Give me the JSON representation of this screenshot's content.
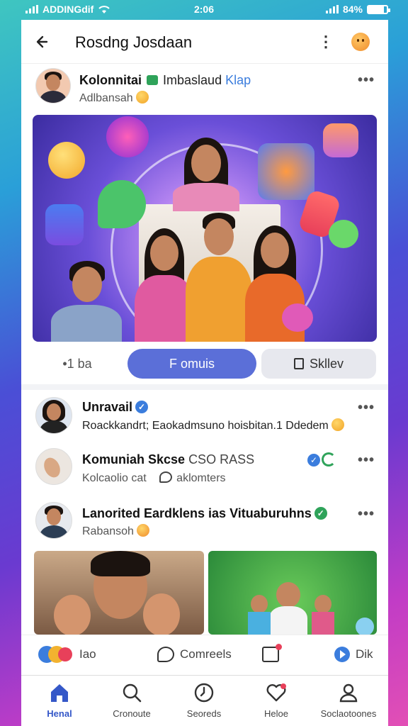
{
  "status_bar": {
    "carrier": "ADDINGdif",
    "time": "2:06",
    "battery_percent": "84%",
    "battery_level": 0.84
  },
  "header": {
    "title": "Rosdng Josdaan"
  },
  "post": {
    "author": "Kolonnitai",
    "group_name": "Imbaslaud",
    "group_tag": "Klap",
    "subtitle": "Adlbansah"
  },
  "actions": {
    "left": "•1 ba",
    "primary": "F omuis",
    "secondary": "Skllev"
  },
  "feed": [
    {
      "name": "Unravail",
      "verified": true,
      "text": "Roackkandrt;  Eaokadmsuno hoisbitan.1 Ddedem"
    },
    {
      "name": "Komuniah Skcse",
      "extra": "CSO RASS",
      "verified": true,
      "text": "Kolcaolio cat",
      "comment": "aklomters"
    },
    {
      "name": "Lanorited Eardklens ias Vituaburuhns",
      "verified": true,
      "text": "Rabansoh"
    }
  ],
  "reactions": [
    {
      "icon": "reactions-icon",
      "label": "Iao"
    },
    {
      "icon": "comment-icon",
      "label": "Comreels"
    },
    {
      "icon": "notification-icon",
      "label": ""
    },
    {
      "icon": "share-icon",
      "label": "Dik"
    }
  ],
  "nav": [
    {
      "icon": "home-icon",
      "label": "Henal",
      "active": true
    },
    {
      "icon": "search-icon",
      "label": "Cronoute"
    },
    {
      "icon": "clock-icon",
      "label": "Seoreds"
    },
    {
      "icon": "heart-icon",
      "label": "Heloe"
    },
    {
      "icon": "profile-icon",
      "label": "Soclaotoones"
    }
  ],
  "colors": {
    "primary": "#5b6fd8",
    "nav_active": "#3558c8",
    "verified_blue": "#3b7ddd",
    "verified_green": "#2fa35a"
  }
}
